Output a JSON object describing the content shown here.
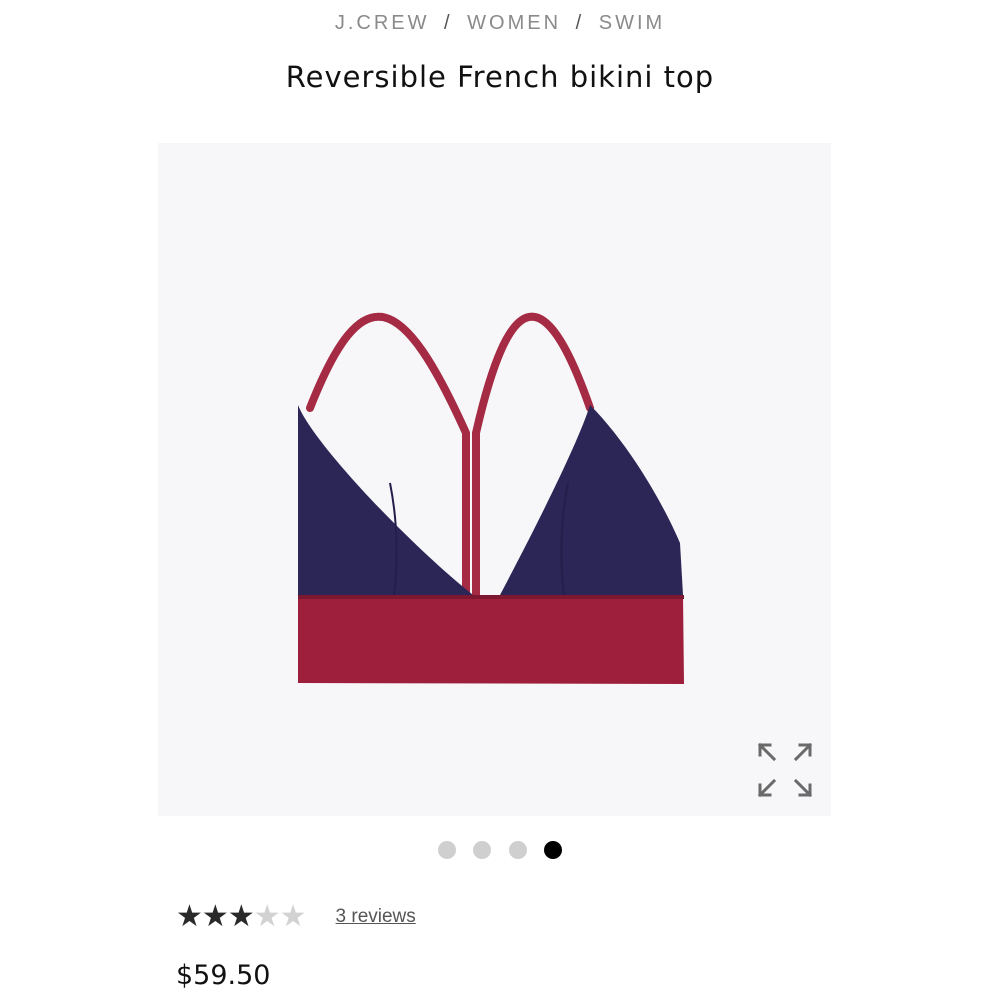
{
  "breadcrumb": {
    "brand": "J.CREW",
    "category": "WOMEN",
    "subcategory": "SWIM",
    "separator": "/"
  },
  "product": {
    "title": "Reversible French bikini top",
    "price": "$59.50",
    "colors": {
      "cup": "#2b2656",
      "band": "#9e1f3b",
      "strap": "#a52a44"
    }
  },
  "gallery": {
    "image_count": 4,
    "active_index": 4,
    "expand_icon": "expand-arrows-icon"
  },
  "rating": {
    "value": 3,
    "max": 5,
    "reviews_label": "3 reviews"
  }
}
